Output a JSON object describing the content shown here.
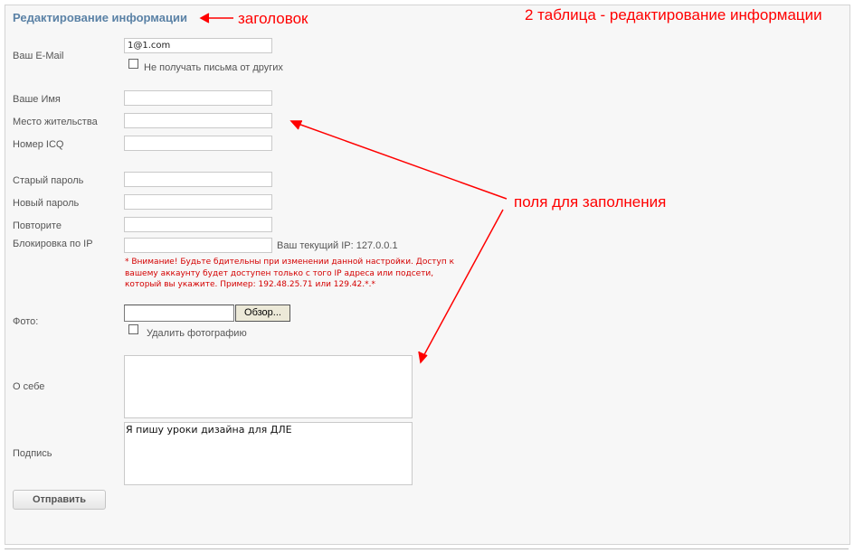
{
  "form": {
    "title": "Редактирование информации",
    "email": {
      "label": "Ваш E-Mail",
      "value": "1@1.com"
    },
    "no_mail": {
      "label": "Не получать письма от других"
    },
    "name": {
      "label": "Ваше Имя",
      "value": ""
    },
    "location": {
      "label": "Место жительства",
      "value": ""
    },
    "icq": {
      "label": "Номер ICQ",
      "value": ""
    },
    "old_password": {
      "label": "Старый пароль",
      "value": ""
    },
    "new_password": {
      "label": "Новый пароль",
      "value": ""
    },
    "repeat_password": {
      "label": "Повторите",
      "value": ""
    },
    "ip_block": {
      "label": "Блокировка по IP",
      "value": "",
      "current_ip": "Ваш текущий IP: 127.0.0.1",
      "warning_lines": [
        "* Внимание! Будьте бдительны при изменении данной настройки. Доступ к",
        "вашему аккаунту будет доступен только с того IP адреса или подсети,",
        "который вы укажите. Пример: 192.48.25.71 или 129.42.*.*"
      ]
    },
    "photo": {
      "label": "Фото:",
      "browse": "Обзор...",
      "delete_label": "Удалить фотографию"
    },
    "about": {
      "label": "О себе",
      "value": ""
    },
    "signature": {
      "label": "Подпись",
      "value": "Я пишу уроки дизайна для ДЛЕ"
    },
    "submit": "Отправить"
  },
  "annotations": {
    "header": "заголовок",
    "table": "2 таблица - редактирование информации",
    "fields": "поля для заполнения",
    "color": "#ff0000"
  }
}
